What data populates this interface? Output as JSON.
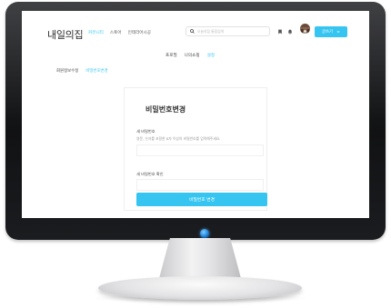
{
  "header": {
    "brand": "내일의집",
    "nav": [
      "커뮤니티",
      "스토어",
      "인테리어시공"
    ],
    "search_placeholder": "오늘의집 통합검색",
    "write_label": "글쓰기"
  },
  "subnav": [
    "프로필",
    "나의쇼핑",
    "설정"
  ],
  "breadcrumb": [
    "회원정보수정",
    "비밀번호변경"
  ],
  "form": {
    "title": "비밀번호변경",
    "new_password_label": "새 비밀번호",
    "new_password_hint": "영문, 숫자를 포함한 8자 이상의 비밀번호를 입력해주세요.",
    "confirm_label": "새 비밀번호 확인",
    "submit_label": "비밀번호 변경"
  },
  "colors": {
    "accent": "#35c5f0",
    "bezel": "#1b1c1f",
    "power_light": "#1e7fd6"
  }
}
